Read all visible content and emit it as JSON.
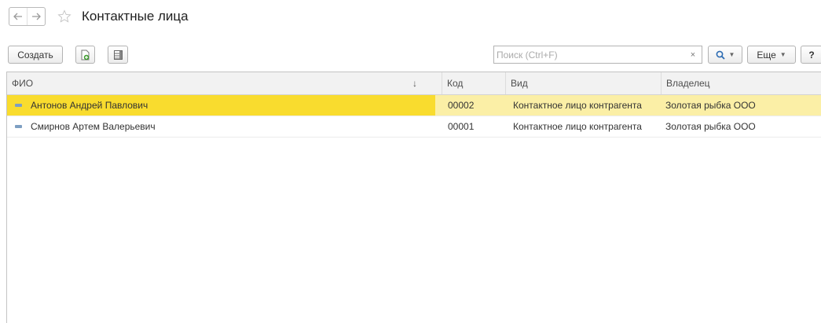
{
  "title": "Контактные лица",
  "toolbar": {
    "create_label": "Создать",
    "search_placeholder": "Поиск (Ctrl+F)",
    "search_clear": "×",
    "more_label": "Еще",
    "help_label": "?"
  },
  "table": {
    "columns": [
      "ФИО",
      "Код",
      "Вид",
      "Владелец"
    ],
    "sort_indicator": "↓",
    "rows": [
      {
        "name": "Антонов Андрей Павлович",
        "code": "00002",
        "kind": "Контактное лицо контрагента",
        "owner": "Золотая рыбка ООО",
        "selected": true
      },
      {
        "name": "Смирнов Артем Валерьевич",
        "code": "00001",
        "kind": "Контактное лицо контрагента",
        "owner": "Золотая рыбка ООО",
        "selected": false
      }
    ]
  },
  "colors": {
    "selected_row": "#fbefa6",
    "selected_cell": "#f9dc2e",
    "header_bg": "#f2f2f2"
  },
  "icons": [
    "back-arrow-icon",
    "forward-arrow-icon",
    "star-icon",
    "add-copy-icon",
    "list-settings-icon",
    "search-icon",
    "row-marker-icon"
  ]
}
